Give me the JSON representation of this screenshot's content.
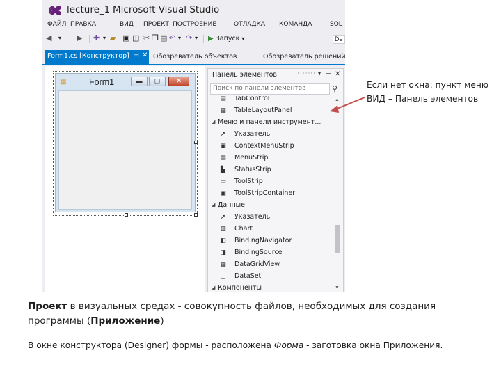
{
  "ide": {
    "title": "lecture_1",
    "app_name": "Microsoft Visual Studio",
    "menu": [
      "ФАЙЛ",
      "ПРАВКА",
      "ВИД",
      "ПРОЕКТ",
      "ПОСТРОЕНИЕ",
      "ОТЛАДКА",
      "КОМАНДА",
      "SQL"
    ],
    "toolbar": {
      "run_label": "Запуск",
      "config_partial": "De"
    },
    "tabs": {
      "active": "Form1.cs [Конструктор]",
      "object_browser": "Обозреватель объектов",
      "solution_explorer": "Обозреватель решений"
    },
    "form": {
      "title": "Form1"
    },
    "toolbox": {
      "title": "Панель элементов",
      "search_placeholder": "Поиск по панели элементов",
      "rows": [
        {
          "kind": "item",
          "label": "TabControl",
          "icon": "tab-control-icon",
          "glyph": "▤"
        },
        {
          "kind": "item",
          "label": "TableLayoutPanel",
          "icon": "table-layout-icon",
          "glyph": "▦"
        },
        {
          "kind": "group",
          "label": "Меню и панели инструмент..."
        },
        {
          "kind": "item",
          "label": "Указатель",
          "icon": "pointer-icon",
          "glyph": "➚"
        },
        {
          "kind": "item",
          "label": "ContextMenuStrip",
          "icon": "context-menu-icon",
          "glyph": "▣"
        },
        {
          "kind": "item",
          "label": "MenuStrip",
          "icon": "menu-strip-icon",
          "glyph": "▤"
        },
        {
          "kind": "item",
          "label": "StatusStrip",
          "icon": "status-strip-icon",
          "glyph": "▙"
        },
        {
          "kind": "item",
          "label": "ToolStrip",
          "icon": "tool-strip-icon",
          "glyph": "▭"
        },
        {
          "kind": "item",
          "label": "ToolStripContainer",
          "icon": "tool-strip-container-icon",
          "glyph": "▣"
        },
        {
          "kind": "group",
          "label": "Данные"
        },
        {
          "kind": "item",
          "label": "Указатель",
          "icon": "pointer-icon",
          "glyph": "➚"
        },
        {
          "kind": "item",
          "label": "Chart",
          "icon": "chart-icon",
          "glyph": "▥"
        },
        {
          "kind": "item",
          "label": "BindingNavigator",
          "icon": "binding-navigator-icon",
          "glyph": "◧"
        },
        {
          "kind": "item",
          "label": "BindingSource",
          "icon": "binding-source-icon",
          "glyph": "◨"
        },
        {
          "kind": "item",
          "label": "DataGridView",
          "icon": "data-grid-icon",
          "glyph": "▦"
        },
        {
          "kind": "item",
          "label": "DataSet",
          "icon": "dataset-icon",
          "glyph": "◫"
        },
        {
          "kind": "group",
          "label": "Компоненты"
        }
      ]
    }
  },
  "callout": "Если нет окна: пункт меню ВИД – Панель элементов",
  "para1": {
    "term1": "Проект",
    "mid": " в визуальных средах  - совокупность файлов, необходимых для создания программы (",
    "term2": "Приложение",
    "end": ")"
  },
  "para2": {
    "start": "В окне конструктора (Designer) формы  - расположена ",
    "term": "Форма",
    "end": "  - заготовка окна Приложения."
  },
  "colors": {
    "accent": "#007acc",
    "vs_purple": "#68217a",
    "arrow": "#c0504d",
    "ide_bg": "#eeeef2"
  }
}
